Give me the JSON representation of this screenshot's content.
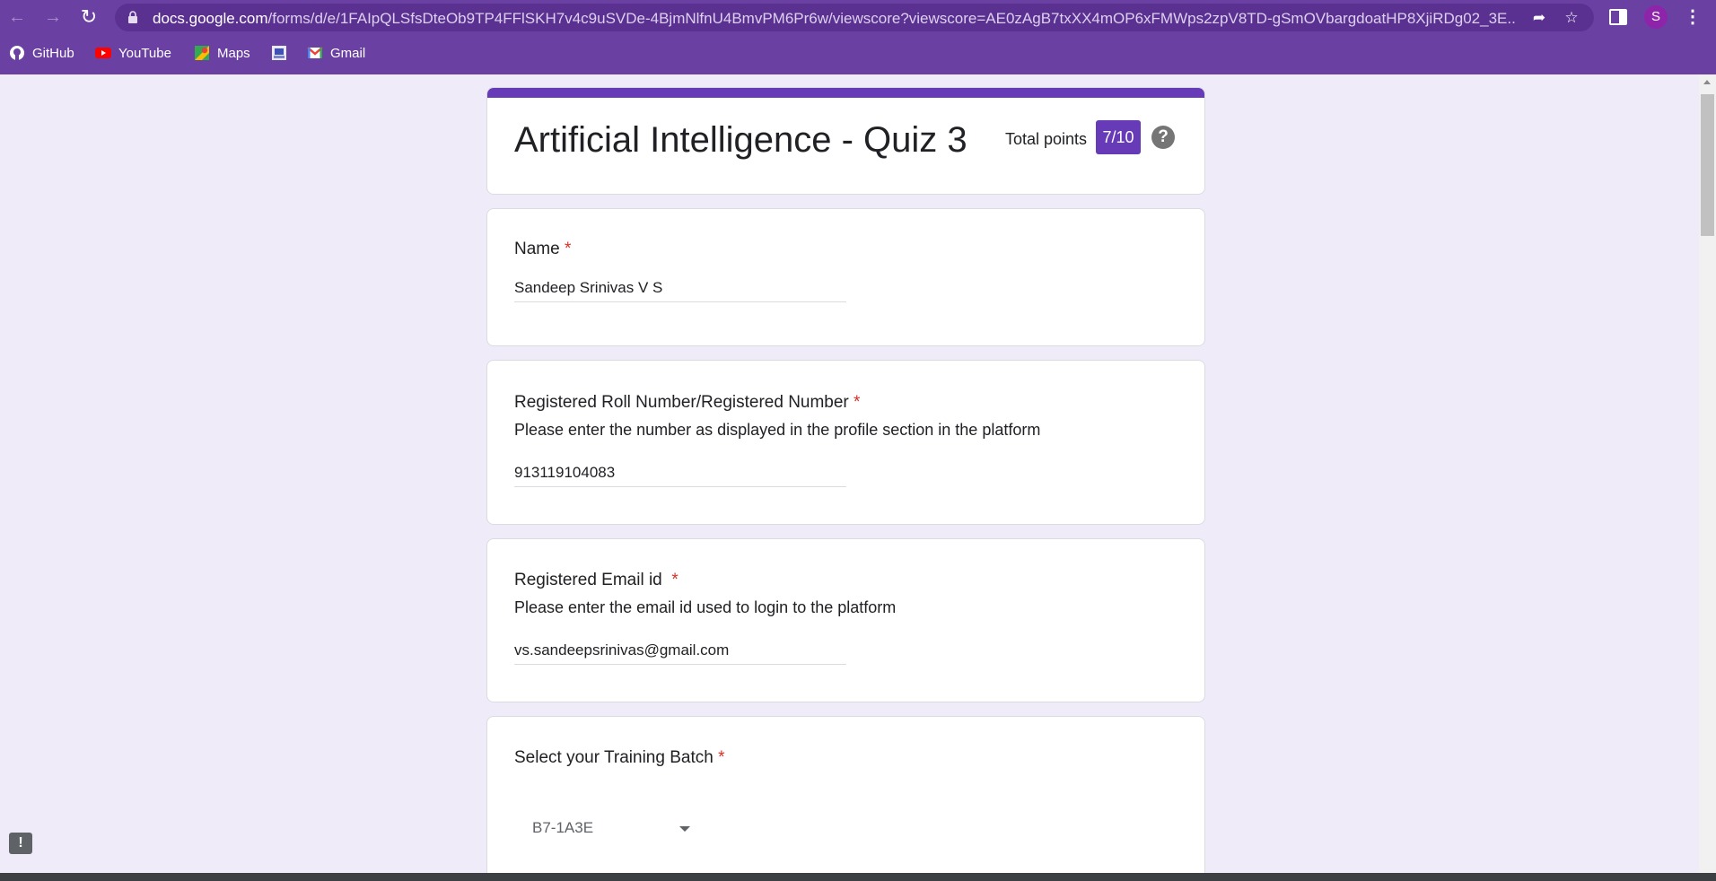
{
  "browser": {
    "url_host": "docs.google.com",
    "url_path": "/forms/d/e/1FAIpQLSfsDteOb9TP4FFlSKH7v4c9uSVDe-4BjmNlfnU4BmvPM6Pr6w/viewscore?viewscore=AE0zAgB7txXX4mOP6xFMWps2zpV8TD-gSmOVbargdoatHP8XjiRDg02_3E...",
    "avatar_letter": "S",
    "bookmarks": [
      {
        "label": "GitHub",
        "icon": "github-icon"
      },
      {
        "label": "YouTube",
        "icon": "youtube-icon"
      },
      {
        "label": "Maps",
        "icon": "maps-icon"
      },
      {
        "label": "",
        "icon": "site-icon"
      },
      {
        "label": "Gmail",
        "icon": "gmail-icon"
      }
    ]
  },
  "form": {
    "title": "Artificial Intelligence - Quiz 3",
    "total_points_label": "Total points",
    "score": "7/10",
    "accent_color": "#673ab7",
    "questions": [
      {
        "title": "Name",
        "required_mark": "*",
        "answer": "Sandeep Srinivas V S"
      },
      {
        "title": "Registered Roll Number/Registered Number",
        "required_mark": "*",
        "description": "Please enter the number as displayed in the profile section in the platform",
        "answer": "913119104083"
      },
      {
        "title": "Registered Email id",
        "required_mark": "*",
        "description": "Please enter the email id used to login to the platform",
        "answer": "vs.sandeepsrinivas@gmail.com"
      },
      {
        "title": "Select your Training Batch",
        "required_mark": "*",
        "selected": "B7-1A3E"
      }
    ]
  }
}
